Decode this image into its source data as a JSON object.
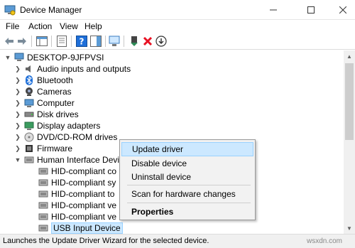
{
  "window": {
    "title": "Device Manager"
  },
  "menu": [
    "File",
    "Action",
    "View",
    "Help"
  ],
  "tree": {
    "root": "DESKTOP-9JFPVSI",
    "categories": [
      "Audio inputs and outputs",
      "Bluetooth",
      "Cameras",
      "Computer",
      "Disk drives",
      "Display adapters",
      "DVD/CD-ROM drives",
      "Firmware",
      "Human Interface Devi"
    ],
    "hid_children": [
      "HID-compliant co",
      "HID-compliant sy",
      "HID-compliant to",
      "HID-compliant ve",
      "HID-compliant ve",
      "USB Input Device"
    ]
  },
  "context_menu": {
    "update": "Update driver",
    "disable": "Disable device",
    "uninstall": "Uninstall device",
    "scan": "Scan for hardware changes",
    "properties": "Properties"
  },
  "status": {
    "text": "Launches the Update Driver Wizard for the selected device."
  },
  "watermark": "wsxdn.com",
  "colors": {
    "selection": "#cce8ff",
    "selection_border": "#99d1ff",
    "delete_red": "#e81123",
    "green": "#2e8b57",
    "blue_icon": "#1e6fd9"
  }
}
